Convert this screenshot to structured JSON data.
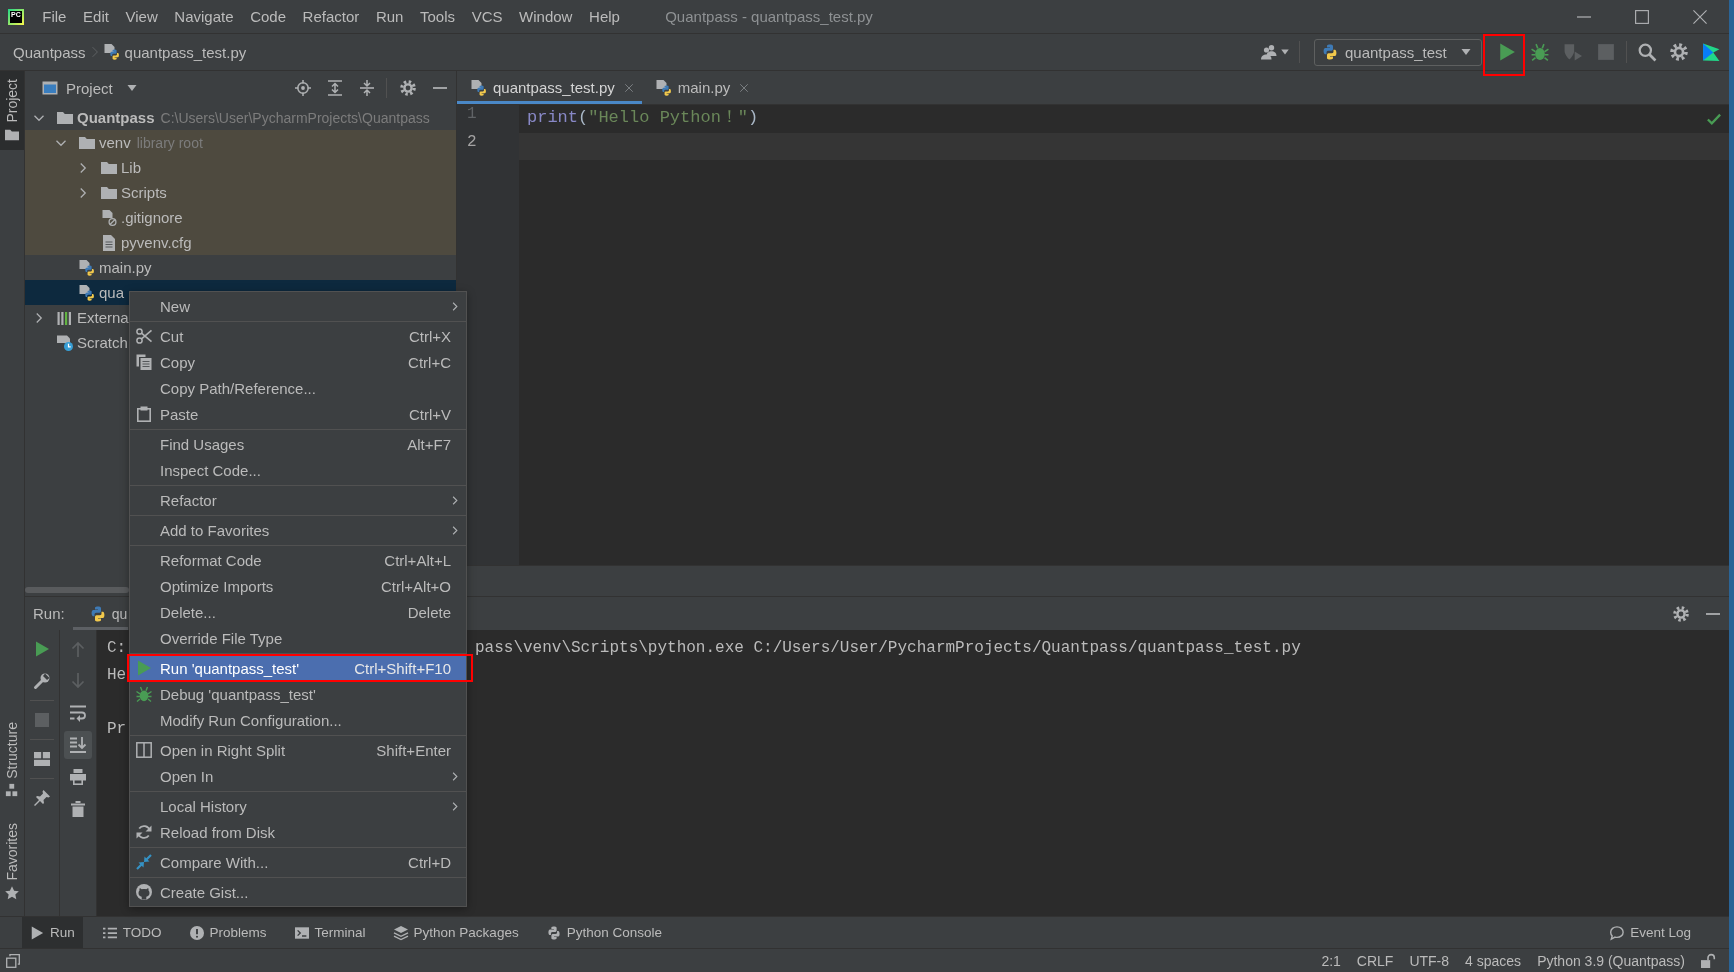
{
  "window": {
    "logo": "PC",
    "menu": [
      "File",
      "Edit",
      "View",
      "Navigate",
      "Code",
      "Refactor",
      "Run",
      "Tools",
      "VCS",
      "Window",
      "Help"
    ],
    "title": "Quantpass - quantpass_test.py"
  },
  "navigation_bar": {
    "breadcrumbs": [
      {
        "label": "Quantpass",
        "kind": "project"
      },
      {
        "label": "quantpass_test.py",
        "kind": "python"
      }
    ],
    "run_configuration": "quantpass_test",
    "actions": [
      {
        "kind": "run",
        "disabled": false,
        "annotated": true
      },
      {
        "kind": "debug",
        "disabled": false,
        "annotated": false
      },
      {
        "kind": "coverage",
        "disabled": true,
        "annotated": false
      },
      {
        "kind": "stop",
        "disabled": true,
        "annotated": false
      }
    ]
  },
  "left_strip": {
    "top": [
      {
        "label": "Project",
        "kind": "project",
        "selected": true
      }
    ],
    "bottom": [
      {
        "label": "Structure",
        "kind": "structure",
        "selected": false
      },
      {
        "label": "Favorites",
        "kind": "favorites",
        "selected": false
      }
    ]
  },
  "project_panel": {
    "title": "Project",
    "tree": [
      {
        "label": "Quantpass",
        "note": "C:\\Users\\User\\PycharmProjects\\Quantpass",
        "kind": "project-root",
        "expanded": true,
        "selected": false,
        "library": false,
        "children": [
          {
            "label": "venv",
            "note": "library root",
            "kind": "folder",
            "expanded": true,
            "selected": false,
            "library": true,
            "children": [
              {
                "label": "Lib",
                "kind": "folder",
                "expanded": false,
                "selected": false,
                "library": true
              },
              {
                "label": "Scripts",
                "kind": "folder",
                "expanded": false,
                "selected": false,
                "library": true
              },
              {
                "label": ".gitignore",
                "kind": "ignore-file",
                "selected": false,
                "library": true
              },
              {
                "label": "pyvenv.cfg",
                "kind": "text-file",
                "selected": false,
                "library": true
              }
            ]
          },
          {
            "label": "main.py",
            "kind": "python",
            "selected": false,
            "library": false
          },
          {
            "label": "qua",
            "kind": "python",
            "selected": true,
            "library": false
          }
        ]
      },
      {
        "label": "Externa",
        "kind": "libraries",
        "expanded": false,
        "selected": false,
        "library": false
      },
      {
        "label": "Scratch",
        "kind": "scratches",
        "selected": false,
        "library": false
      }
    ]
  },
  "editor": {
    "tabs": [
      {
        "label": "quantpass_test.py",
        "selected": true
      },
      {
        "label": "main.py",
        "selected": false
      }
    ],
    "lines": [
      {
        "number": "1",
        "current": false,
        "tokens": [
          {
            "text": "print",
            "kind": "builtin"
          },
          {
            "text": "(",
            "kind": "plain"
          },
          {
            "text": "\"Hello Python！\"",
            "kind": "string"
          },
          {
            "text": ")",
            "kind": "plain"
          }
        ]
      },
      {
        "number": "2",
        "current": true
      }
    ]
  },
  "run_panel": {
    "label": "Run:",
    "tab": "qu",
    "tool_groups": [
      {
        "tools": [
          {
            "kind": "rerun",
            "disabled": false
          },
          {
            "kind": "wrench",
            "disabled": false
          }
        ]
      },
      {
        "tools": [
          {
            "kind": "stop",
            "disabled": true
          }
        ]
      },
      {
        "tools": [
          {
            "kind": "layout",
            "disabled": false
          }
        ]
      },
      {
        "tools": [
          {
            "kind": "pin",
            "disabled": false
          }
        ]
      }
    ],
    "output_tools": [
      {
        "kind": "up",
        "disabled": true,
        "on": false
      },
      {
        "kind": "down",
        "disabled": true,
        "on": false
      },
      {
        "kind": "wrap",
        "disabled": false,
        "on": false
      },
      {
        "kind": "scroll-end",
        "disabled": false,
        "on": true
      },
      {
        "kind": "print",
        "disabled": false,
        "on": false
      },
      {
        "kind": "trash",
        "disabled": false,
        "on": false
      }
    ],
    "console": [
      {
        "kind": "command",
        "start": "C:",
        "rest": "pass\\venv\\Scripts\\python.exe C:/Users/User/PycharmProjects/Quantpass/quantpass_test.py"
      },
      {
        "kind": "output",
        "text": "He"
      },
      {
        "kind": "blank"
      },
      {
        "kind": "output",
        "text": "Pr"
      }
    ]
  },
  "context_menu": {
    "sections": [
      {
        "items": [
          {
            "label": "New",
            "kind": "plain",
            "submenu": true,
            "selected": false,
            "annotated": false
          }
        ]
      },
      {
        "items": [
          {
            "label": "Cut",
            "shortcut": "Ctrl+X",
            "kind": "cut",
            "submenu": false,
            "selected": false,
            "annotated": false
          },
          {
            "label": "Copy",
            "shortcut": "Ctrl+C",
            "kind": "copy",
            "submenu": false,
            "selected": false,
            "annotated": false
          },
          {
            "label": "Copy Path/Reference...",
            "kind": "plain",
            "submenu": false,
            "selected": false,
            "annotated": false
          },
          {
            "label": "Paste",
            "shortcut": "Ctrl+V",
            "kind": "paste",
            "submenu": false,
            "selected": false,
            "annotated": false
          }
        ]
      },
      {
        "items": [
          {
            "label": "Find Usages",
            "shortcut": "Alt+F7",
            "kind": "plain",
            "submenu": false,
            "selected": false,
            "annotated": false
          },
          {
            "label": "Inspect Code...",
            "kind": "plain",
            "submenu": false,
            "selected": false,
            "annotated": false
          }
        ]
      },
      {
        "items": [
          {
            "label": "Refactor",
            "kind": "plain",
            "submenu": true,
            "selected": false,
            "annotated": false
          }
        ]
      },
      {
        "items": [
          {
            "label": "Add to Favorites",
            "kind": "plain",
            "submenu": true,
            "selected": false,
            "annotated": false
          }
        ]
      },
      {
        "items": [
          {
            "label": "Reformat Code",
            "shortcut": "Ctrl+Alt+L",
            "kind": "plain",
            "submenu": false,
            "selected": false,
            "annotated": false
          },
          {
            "label": "Optimize Imports",
            "shortcut": "Ctrl+Alt+O",
            "kind": "plain",
            "submenu": false,
            "selected": false,
            "annotated": false
          },
          {
            "label": "Delete...",
            "shortcut": "Delete",
            "kind": "plain",
            "submenu": false,
            "selected": false,
            "annotated": false
          },
          {
            "label": "Override File Type",
            "kind": "plain",
            "submenu": false,
            "selected": false,
            "annotated": false
          }
        ]
      },
      {
        "items": [
          {
            "label": "Run 'quantpass_test'",
            "shortcut": "Ctrl+Shift+F10",
            "kind": "run",
            "submenu": false,
            "selected": true,
            "annotated": true
          },
          {
            "label": "Debug 'quantpass_test'",
            "kind": "debug",
            "submenu": false,
            "selected": false,
            "annotated": false
          },
          {
            "label": "Modify Run Configuration...",
            "kind": "plain",
            "submenu": false,
            "selected": false,
            "annotated": false
          }
        ]
      },
      {
        "items": [
          {
            "label": "Open in Right Split",
            "shortcut": "Shift+Enter",
            "kind": "split",
            "submenu": false,
            "selected": false,
            "annotated": false
          },
          {
            "label": "Open In",
            "kind": "plain",
            "submenu": true,
            "selected": false,
            "annotated": false
          }
        ]
      },
      {
        "items": [
          {
            "label": "Local History",
            "kind": "plain",
            "submenu": true,
            "selected": false,
            "annotated": false
          },
          {
            "label": "Reload from Disk",
            "kind": "reload",
            "submenu": false,
            "selected": false,
            "annotated": false
          }
        ]
      },
      {
        "items": [
          {
            "label": "Compare With...",
            "shortcut": "Ctrl+D",
            "kind": "compare",
            "submenu": false,
            "selected": false,
            "annotated": false
          }
        ]
      },
      {
        "items": [
          {
            "label": "Create Gist...",
            "kind": "gist",
            "submenu": false,
            "selected": false,
            "annotated": false
          }
        ]
      }
    ]
  },
  "bottom_bar": {
    "tools": [
      {
        "label": "Run",
        "kind": "run",
        "selected": true
      },
      {
        "label": "TODO",
        "kind": "todo",
        "selected": false
      },
      {
        "label": "Problems",
        "kind": "problems",
        "selected": false
      },
      {
        "label": "Terminal",
        "kind": "terminal",
        "selected": false
      },
      {
        "label": "Python Packages",
        "kind": "packages",
        "selected": false
      },
      {
        "label": "Python Console",
        "kind": "console",
        "selected": false
      }
    ],
    "event_log": "Event Log"
  },
  "status_bar": {
    "items": [
      "2:1",
      "CRLF",
      "UTF-8",
      "4 spaces",
      "Python 3.9 (Quantpass)"
    ]
  }
}
